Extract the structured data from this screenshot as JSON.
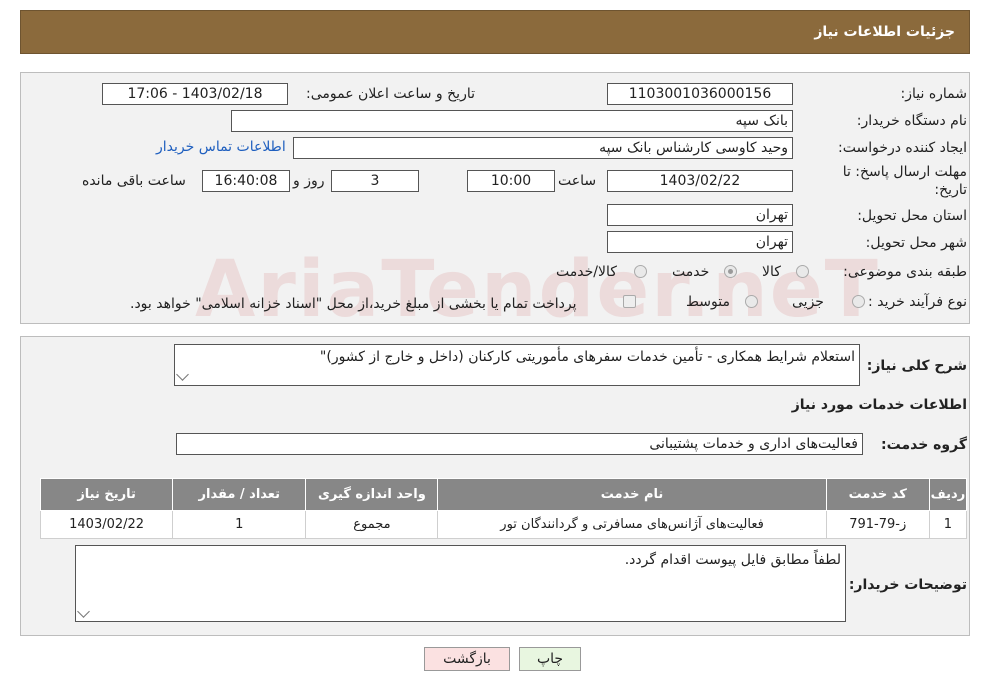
{
  "header": {
    "title": "جزئیات اطلاعات نیاز"
  },
  "form": {
    "need_number_label": "شماره نیاز:",
    "need_number": "1103001036000156",
    "announce_label": "تاریخ و ساعت اعلان عمومی:",
    "announce_value": "1403/02/18 - 17:06",
    "buyer_org_label": "نام دستگاه خریدار:",
    "buyer_org": "بانک سپه",
    "creator_label": "ایجاد کننده درخواست:",
    "creator": "وحید کاوسی کارشناس بانک سپه",
    "contact_link": "اطلاعات تماس خریدار",
    "deadline_label_1": "مهلت ارسال پاسخ: تا",
    "deadline_label_2": "تاریخ:",
    "deadline_date": "1403/02/22",
    "time_label": "ساعت",
    "deadline_time": "10:00",
    "days_value": "3",
    "days_label": "روز و",
    "remaining_time": "16:40:08",
    "remaining_label": "ساعت باقی مانده",
    "province_label": "استان محل تحویل:",
    "province": "تهران",
    "city_label": "شهر محل تحویل:",
    "city": "تهران",
    "category_label": "طبقه بندی موضوعی:",
    "category_options": [
      "کالا",
      "خدمت",
      "کالا/خدمت"
    ],
    "category_selected": "خدمت",
    "process_label": "نوع فرآیند خرید :",
    "process_options": [
      "جزیی",
      "متوسط"
    ],
    "payment_note": "پرداخت تمام یا بخشی از مبلغ خرید،از محل \"اسناد خزانه اسلامی\" خواهد بود."
  },
  "summary": {
    "label": "شرح کلی نیاز:",
    "value": "استعلام شرایط همکاری - تأمین خدمات سفرهای مأموریتی کارکنان (داخل و خارج از کشور)\""
  },
  "services": {
    "section_title": "اطلاعات خدمات مورد نیاز",
    "group_label": "گروه خدمت:",
    "group_value": "فعالیت‌های اداری و خدمات پشتیبانی",
    "columns": [
      "ردیف",
      "کد خدمت",
      "نام خدمت",
      "واحد اندازه گیری",
      "تعداد / مقدار",
      "تاریخ نیاز"
    ],
    "rows": [
      [
        "1",
        "ز-79-791",
        "فعالیت‌های آژانس‌های مسافرتی و گردانندگان تور",
        "مجموع",
        "1",
        "1403/02/22"
      ]
    ]
  },
  "buyer_notes": {
    "label": "توضیحات خریدار:",
    "value": "لطفاً مطابق فایل پیوست اقدام گردد."
  },
  "buttons": {
    "print": "چاپ",
    "back": "بازگشت"
  },
  "watermark": "AriaTender.neT",
  "colors": {
    "header": "#8b6a3c",
    "table_header": "#878787",
    "link": "#1f5fbf",
    "print_btn": "#e8f6e0",
    "back_btn": "#fbe1e1"
  }
}
